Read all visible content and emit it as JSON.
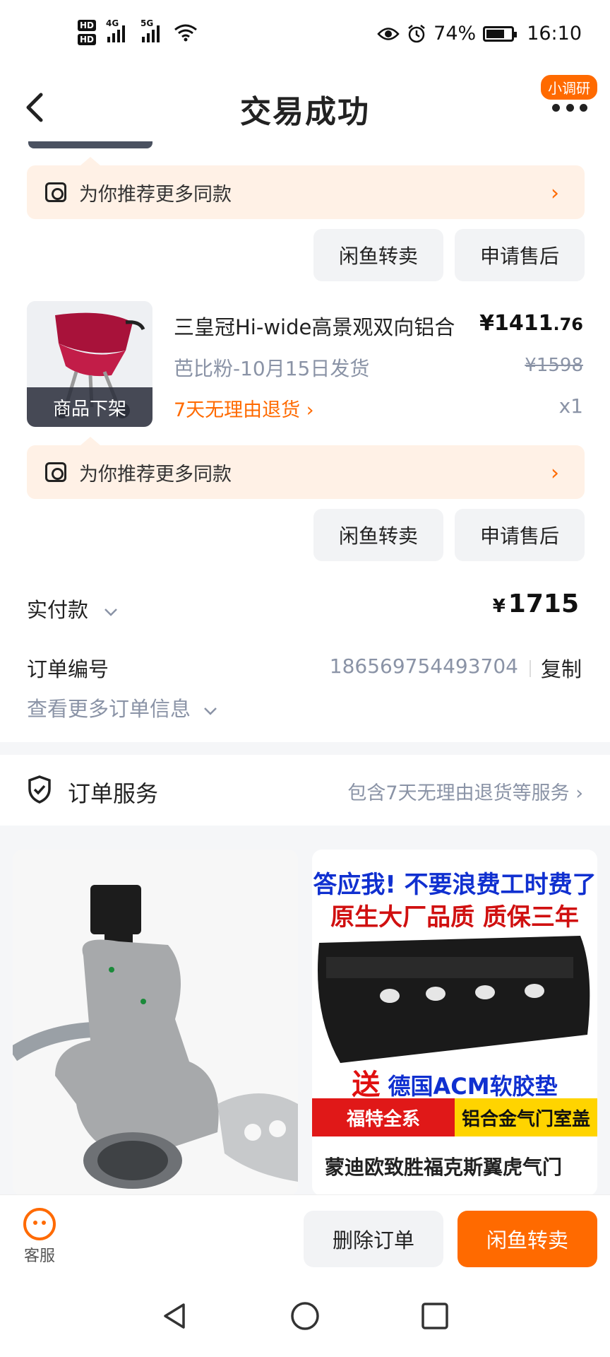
{
  "status_bar": {
    "battery": "74%",
    "time": "16:10",
    "net1": "4G",
    "net2": "5G",
    "sim1": "HD",
    "sim2": "HD"
  },
  "header": {
    "title": "交易成功",
    "survey_badge": "小调研"
  },
  "recommend": {
    "label": "为你推荐更多同款"
  },
  "actions": {
    "resell": "闲鱼转卖",
    "after_sale": "申请售后"
  },
  "product": {
    "name": "三皇冠Hi-wide高景观双向铝合",
    "price_symbol": "¥",
    "price_int": "1411",
    "price_dec": ".76",
    "shipping": "芭比粉-10月15日发货",
    "original_price": "¥1598",
    "return_policy": "7天无理由退货",
    "quantity": "x1",
    "status_overlay": "商品下架"
  },
  "payment": {
    "label": "实付款",
    "currency": "¥",
    "amount": "1715"
  },
  "order": {
    "label": "订单编号",
    "number": "186569754493704",
    "copy": "复制",
    "more_info": "查看更多订单信息"
  },
  "service": {
    "label": "订单服务",
    "desc": "包含7天无理由退货等服务"
  },
  "ads": {
    "card2": {
      "line1": "答应我! 不要浪费工时费了",
      "line2": "原生大厂品质 质保三年",
      "gift_prefix": "送",
      "gift": "德国ACM软胶垫",
      "band_left": "福特全系",
      "band_right": "铝合金气门室盖",
      "title": "蒙迪欧致胜福克斯翼虎气门"
    }
  },
  "bottom": {
    "customer_service": "客服",
    "delete_order": "删除订单",
    "resell": "闲鱼转卖"
  },
  "colors": {
    "accent": "#ff6a00",
    "recommend_bg": "#fff1e6",
    "muted": "#8a93a6"
  }
}
